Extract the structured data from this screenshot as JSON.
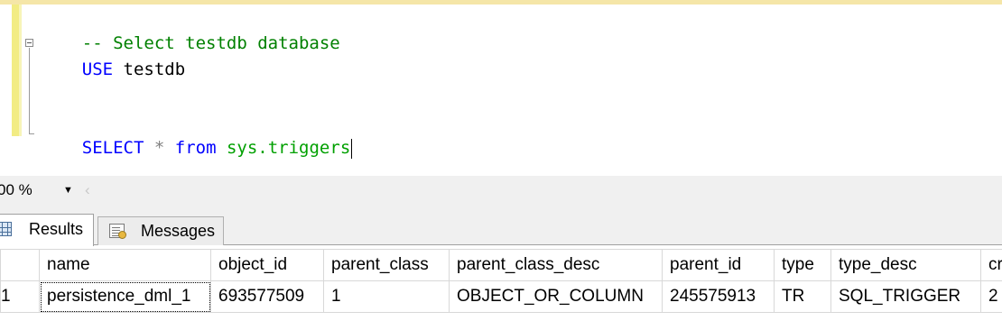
{
  "editor": {
    "lines": [
      {
        "parts": [
          {
            "cls": "cmt",
            "text": "-- Select testdb database"
          }
        ]
      },
      {
        "parts": [
          {
            "cls": "kw",
            "text": "USE"
          },
          {
            "cls": "plain",
            "text": " testdb"
          }
        ]
      },
      {
        "parts": []
      },
      {
        "parts": []
      },
      {
        "parts": [
          {
            "cls": "kw",
            "text": "SELECT"
          },
          {
            "cls": "plain",
            "text": " "
          },
          {
            "cls": "op",
            "text": "*"
          },
          {
            "cls": "plain",
            "text": " "
          },
          {
            "cls": "kw",
            "text": "from"
          },
          {
            "cls": "plain",
            "text": " "
          },
          {
            "cls": "sysobj",
            "text": "sys.triggers"
          }
        ]
      }
    ]
  },
  "statusbar": {
    "zoom": "00 %",
    "zoom_arrow": "▼",
    "scroll_left": "‹"
  },
  "tabs": {
    "results": "Results",
    "messages": "Messages"
  },
  "grid": {
    "columns": [
      "name",
      "object_id",
      "parent_class",
      "parent_class_desc",
      "parent_id",
      "type",
      "type_desc",
      "cr"
    ],
    "rows": [
      {
        "rownum": "1",
        "cells": [
          "persistence_dml_1",
          "693577509",
          "1",
          "OBJECT_OR_COLUMN",
          "245575913",
          "TR",
          "SQL_TRIGGER",
          "2"
        ]
      }
    ]
  },
  "colors": {
    "keyword": "#0000ff",
    "comment": "#008000",
    "system_object": "#00a000",
    "operator": "#808080"
  }
}
